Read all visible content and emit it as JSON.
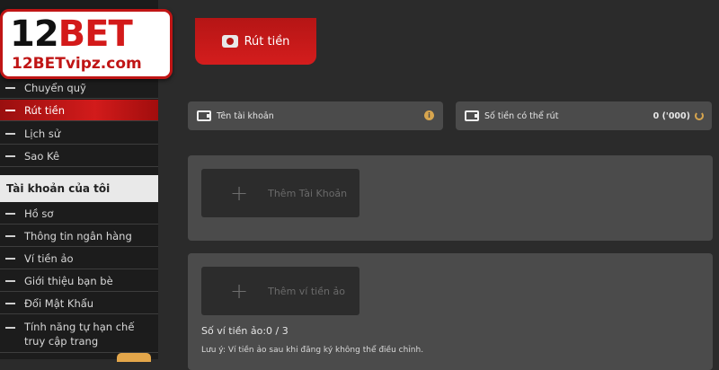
{
  "logo": {
    "brand_number": "12",
    "brand_word": "BET",
    "site": "12BETvipz.com"
  },
  "sidebar": {
    "items_top": [
      {
        "label": "Chuyển quỹ"
      },
      {
        "label": "Rút tiền"
      },
      {
        "label": "Lịch sử"
      },
      {
        "label": "Sao Kê"
      }
    ],
    "section_title": "Tài khoản của tôi",
    "items_account": [
      {
        "label": "Hồ sơ"
      },
      {
        "label": "Thông tin ngân hàng"
      },
      {
        "label": "Ví tiền ảo"
      },
      {
        "label": "Giới thiệu bạn bè"
      },
      {
        "label": "Đổi Mật Khẩu"
      },
      {
        "label": "Tính năng tự hạn chế truy cập trang"
      }
    ]
  },
  "main": {
    "tab_label": "Rút tiền",
    "account_name_label": "Tên tài khoản",
    "withdrawable_label": "Số tiền có thể rút",
    "withdrawable_value": "0 ('000)",
    "add_account_label": "Thêm Tài Khoản",
    "add_wallet_label": "Thêm ví tiền ảo",
    "wallet_count": "Số ví tiền ảo:0 / 3",
    "note": "Lưu ý: Ví tiền ảo sau khi đăng ký không thể điều chỉnh."
  },
  "colors": {
    "accent": "#d21b1b",
    "gold": "#d7a54e",
    "panel": "#4b4b4b"
  }
}
